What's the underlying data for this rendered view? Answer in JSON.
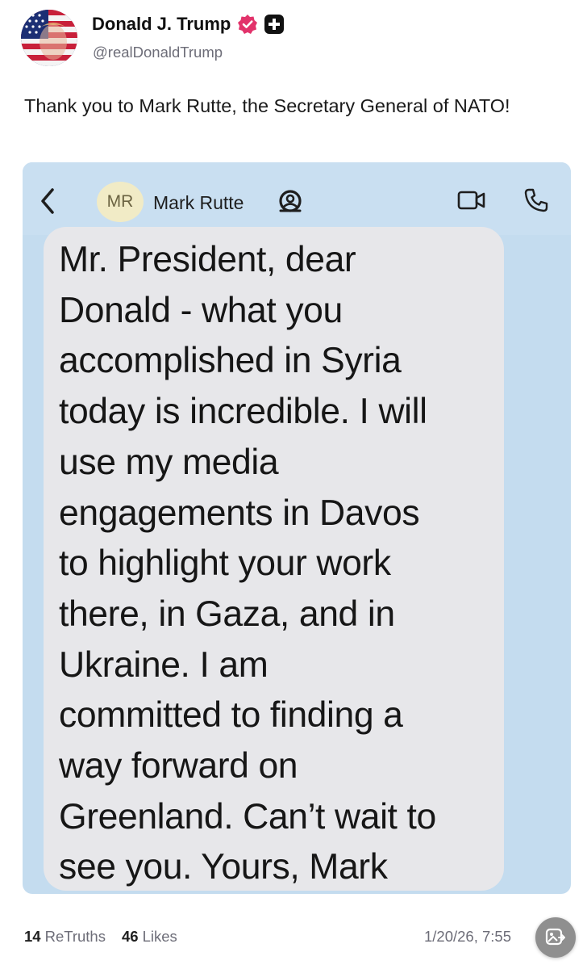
{
  "author": {
    "display_name": "Donald J. Trump",
    "handle": "@realDonaldTrump"
  },
  "post": {
    "text": "Thank you to Mark Rutte, the Secretary General of NATO!"
  },
  "screenshot": {
    "contact_initials": "MR",
    "contact_name": "Mark Rutte",
    "message": "Mr. President, dear\nDonald - what you\naccomplished in Syria\ntoday is incredible. I will\nuse my media\nengagements in Davos\nto highlight your work\nthere, in Gaza, and in\nUkraine. I am\ncommitted to finding a\nway forward on\nGreenland. Can’t wait to\nsee you. Yours, Mark"
  },
  "stats": {
    "retruths_count": "14",
    "retruths_label": "ReTruths",
    "likes_count": "46",
    "likes_label": "Likes",
    "timestamp": "1/20/26, 7:55"
  },
  "colors": {
    "verified": "#e2336b",
    "screenshot_bg": "#c4dcef",
    "bubble": "#e7e7ea"
  }
}
